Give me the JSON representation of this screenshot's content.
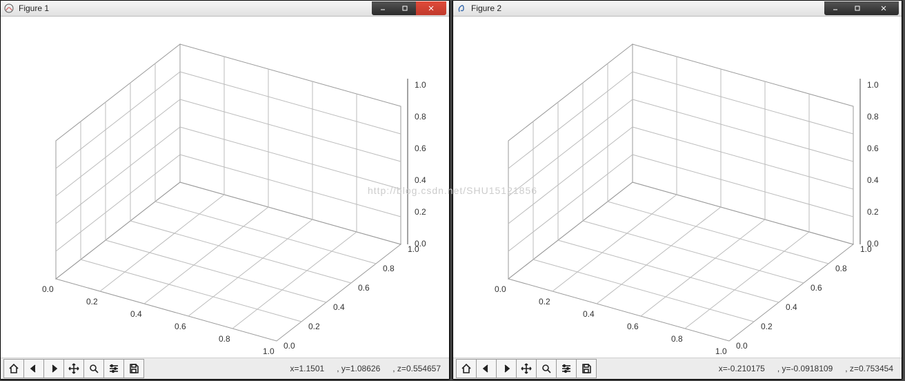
{
  "watermark": "http://blog.csdn.net/SHU15121856",
  "windows": [
    {
      "title": "Figure 1",
      "status": {
        "x": "x=1.1501",
        "y": ", y=1.08626",
        "z": ", z=0.554657"
      }
    },
    {
      "title": "Figure 2",
      "status": {
        "x": "x=-0.210175",
        "y": ", y=-0.0918109",
        "z": ", z=0.753454"
      }
    }
  ],
  "toolbar_icons": [
    "home-icon",
    "back-icon",
    "forward-icon",
    "pan-icon",
    "zoom-icon",
    "configure-icon",
    "save-icon"
  ],
  "chart_data": [
    {
      "type": "3d_axes",
      "title": "",
      "xlabel": "",
      "ylabel": "",
      "zlabel": "",
      "xlim": [
        0.0,
        1.0
      ],
      "ylim": [
        0.0,
        1.0
      ],
      "zlim": [
        0.0,
        1.0
      ],
      "x_ticks": [
        "0.0",
        "0.2",
        "0.4",
        "0.6",
        "0.8",
        "1.0"
      ],
      "y_ticks": [
        "0.0",
        "0.2",
        "0.4",
        "0.6",
        "0.8",
        "1.0"
      ],
      "z_ticks": [
        "0.0",
        "0.2",
        "0.4",
        "0.6",
        "0.8",
        "1.0"
      ],
      "grid": true,
      "series": []
    },
    {
      "type": "3d_axes",
      "title": "",
      "xlabel": "",
      "ylabel": "",
      "zlabel": "",
      "xlim": [
        0.0,
        1.0
      ],
      "ylim": [
        0.0,
        1.0
      ],
      "zlim": [
        0.0,
        1.0
      ],
      "x_ticks": [
        "0.0",
        "0.2",
        "0.4",
        "0.6",
        "0.8",
        "1.0"
      ],
      "y_ticks": [
        "0.0",
        "0.2",
        "0.4",
        "0.6",
        "0.8",
        "1.0"
      ],
      "z_ticks": [
        "0.0",
        "0.2",
        "0.4",
        "0.6",
        "0.8",
        "1.0"
      ],
      "grid": true,
      "series": []
    }
  ]
}
